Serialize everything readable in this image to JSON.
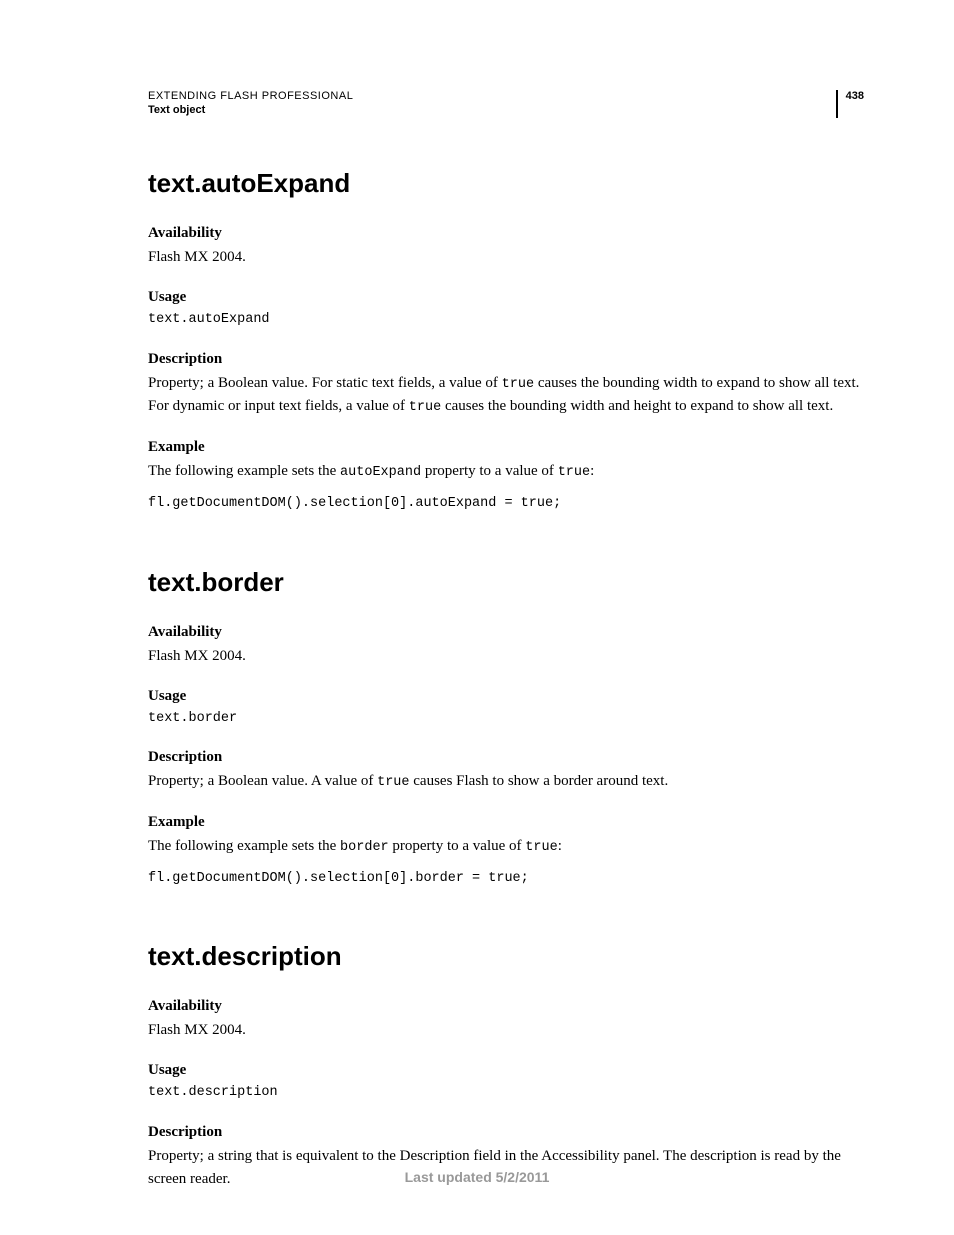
{
  "header": {
    "title": "EXTENDING FLASH PROFESSIONAL",
    "subtitle": "Text object",
    "page_number": "438"
  },
  "sections": [
    {
      "title": "text.autoExpand",
      "availability_label": "Availability",
      "availability_text": "Flash MX 2004.",
      "usage_label": "Usage",
      "usage_code": "text.autoExpand",
      "description_label": "Description",
      "description_pre": "Property; a Boolean value. For static text fields, a value of ",
      "description_code1": "true",
      "description_mid": " causes the bounding width to expand to show all text. For dynamic or input text fields, a value of ",
      "description_code2": "true",
      "description_post": " causes the bounding width and height to expand to show all text.",
      "example_label": "Example",
      "example_pre": "The following example sets the ",
      "example_code_prop": "autoExpand",
      "example_mid": " property to a value of ",
      "example_code_val": "true",
      "example_post": ":",
      "example_code": "fl.getDocumentDOM().selection[0].autoExpand = true;"
    },
    {
      "title": "text.border",
      "availability_label": "Availability",
      "availability_text": "Flash MX 2004.",
      "usage_label": "Usage",
      "usage_code": "text.border",
      "description_label": "Description",
      "description_pre": "Property; a Boolean value. A value of ",
      "description_code1": "true",
      "description_mid": "",
      "description_code2": "",
      "description_post": " causes Flash to show a border around text.",
      "example_label": "Example",
      "example_pre": "The following example sets the ",
      "example_code_prop": "border",
      "example_mid": " property to a value of ",
      "example_code_val": "true",
      "example_post": ":",
      "example_code": "fl.getDocumentDOM().selection[0].border = true;"
    },
    {
      "title": "text.description",
      "availability_label": "Availability",
      "availability_text": "Flash MX 2004.",
      "usage_label": "Usage",
      "usage_code": "text.description",
      "description_label": "Description",
      "description_pre": "Property; a string that is equivalent to the Description field in the Accessibility panel. The description is read by the screen reader.",
      "description_code1": "",
      "description_mid": "",
      "description_code2": "",
      "description_post": "",
      "example_label": "",
      "example_pre": "",
      "example_code_prop": "",
      "example_mid": "",
      "example_code_val": "",
      "example_post": "",
      "example_code": ""
    }
  ],
  "footer": "Last updated 5/2/2011"
}
